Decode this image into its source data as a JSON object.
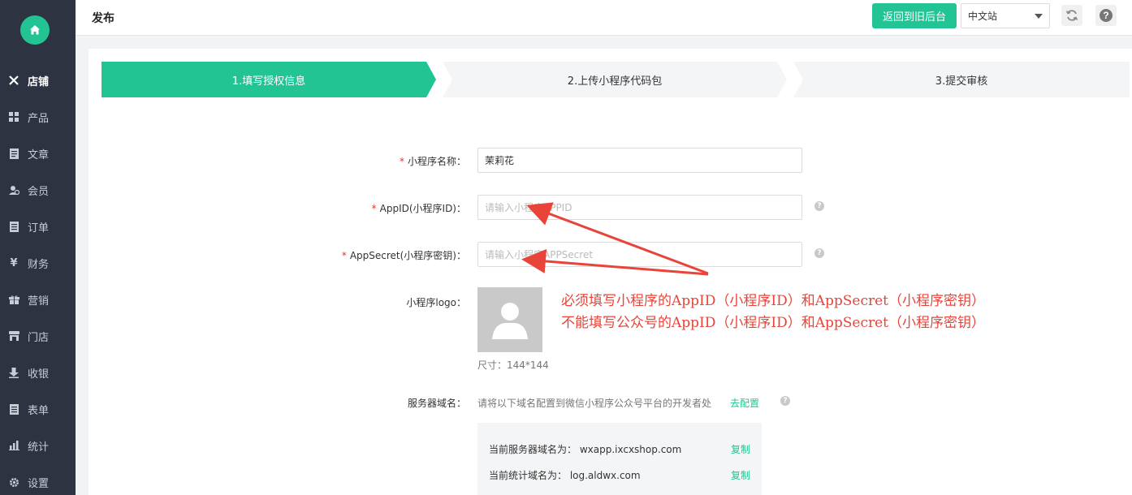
{
  "sidebar": {
    "items": [
      {
        "label": "店铺",
        "icon": "tools-icon",
        "active": true
      },
      {
        "label": "产品",
        "icon": "grid-icon"
      },
      {
        "label": "文章",
        "icon": "document-icon"
      },
      {
        "label": "会员",
        "icon": "user-icon"
      },
      {
        "label": "订单",
        "icon": "order-icon"
      },
      {
        "label": "财务",
        "icon": "yen-icon"
      },
      {
        "label": "营销",
        "icon": "gift-icon"
      },
      {
        "label": "门店",
        "icon": "store-icon"
      },
      {
        "label": "收银",
        "icon": "download-icon"
      },
      {
        "label": "表单",
        "icon": "form-icon"
      },
      {
        "label": "统计",
        "icon": "chart-icon"
      },
      {
        "label": "设置",
        "icon": "gear-icon"
      }
    ]
  },
  "header": {
    "title": "发布",
    "back_button": "返回到旧后台",
    "lang_value": "中文站"
  },
  "steps": [
    {
      "label": "1.填写授权信息",
      "active": true
    },
    {
      "label": "2.上传小程序代码包"
    },
    {
      "label": "3.提交审核"
    }
  ],
  "form": {
    "name_label": "小程序名称：",
    "name_value": "茉莉花",
    "appid_label": "AppID(小程序ID)：",
    "appid_placeholder": "请输入小程序APPID",
    "secret_label": "AppSecret(小程序密钥)：",
    "secret_placeholder": "请输入小程序APPSecret",
    "logo_label": "小程序logo：",
    "logo_size": "尺寸：144*144",
    "server_label": "服务器域名：",
    "server_hint": "请将以下域名配置到微信小程序公众号平台的开发者处",
    "config_link": "去配置",
    "server_domain": "当前服务器域名为： wxapp.ixcxshop.com",
    "stats_domain": "当前统计域名为： log.aldwx.com",
    "copy_label": "复制"
  },
  "annotation": {
    "line1": "必须填写小程序的AppID（小程序ID）和AppSecret（小程序密钥）",
    "line2": "不能填写公众号的AppID（小程序ID）和AppSecret（小程序密钥）"
  },
  "colors": {
    "accent": "#23c493",
    "sidebar_bg": "#2d3340",
    "annotation": "#e8443a"
  }
}
